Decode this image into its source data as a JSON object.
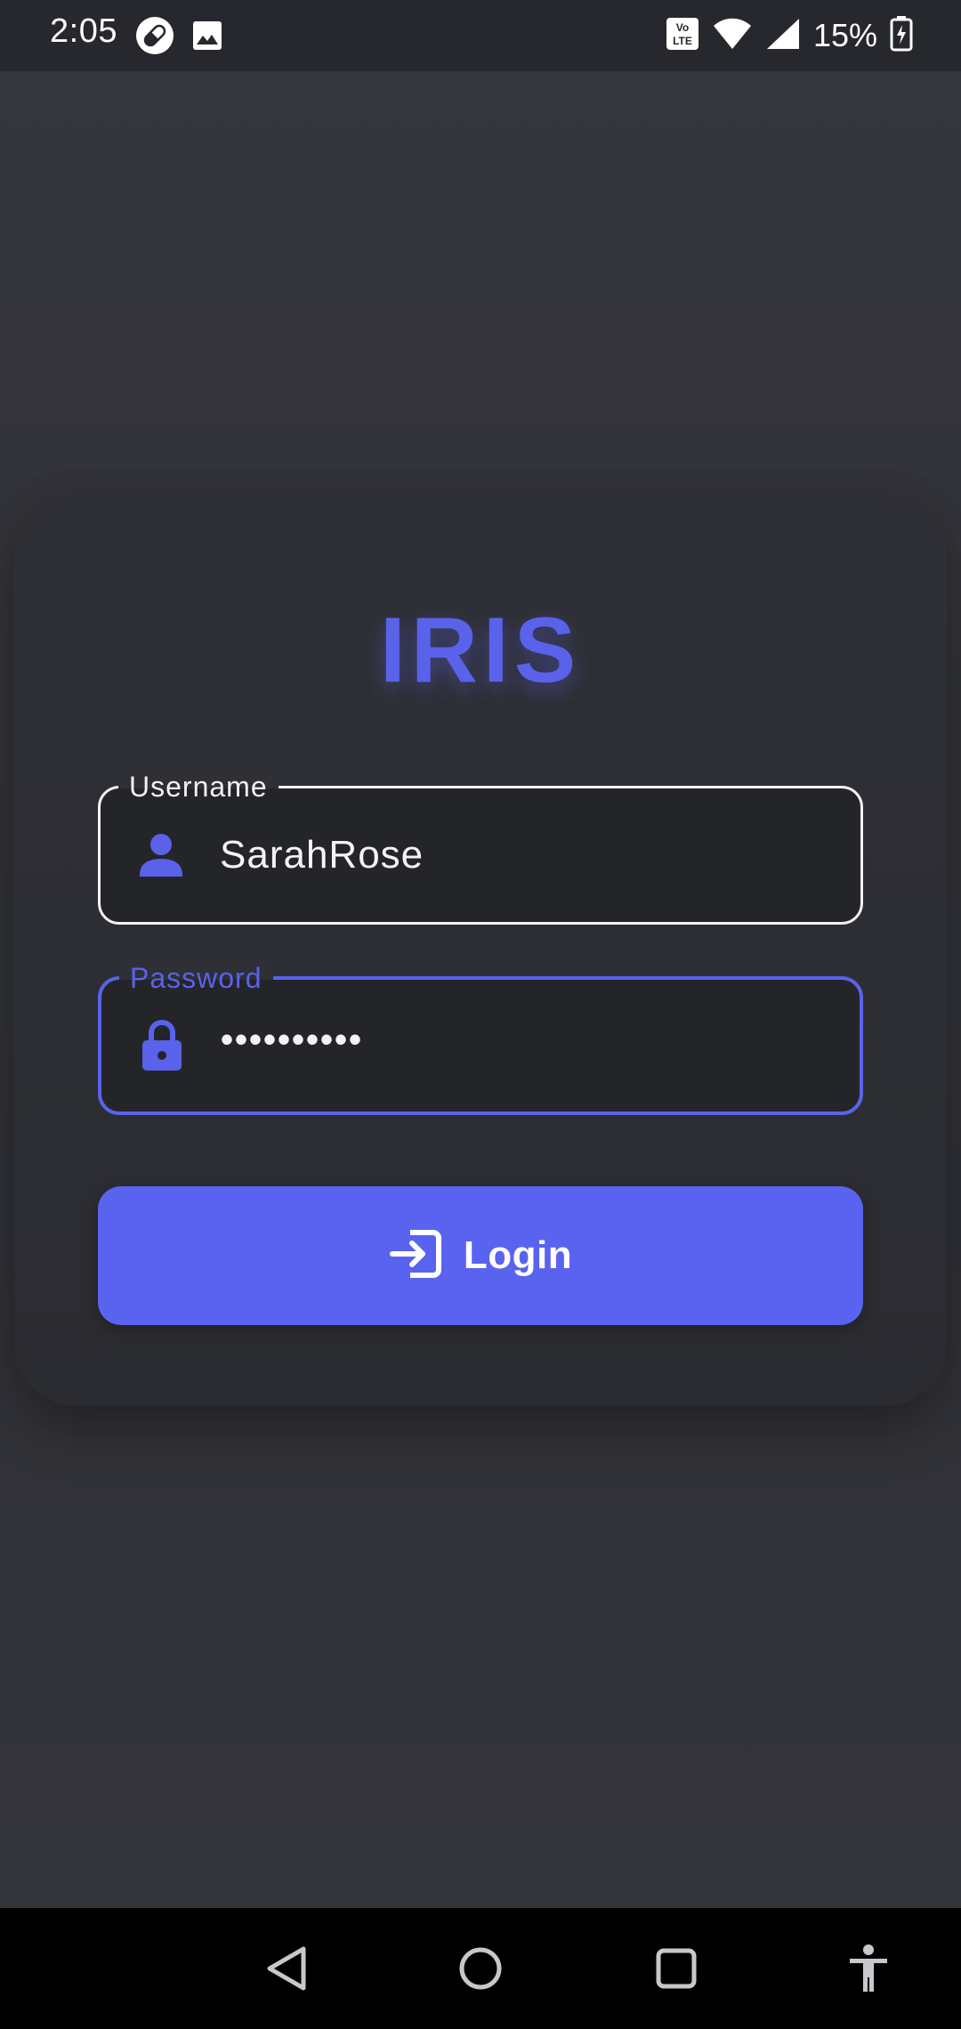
{
  "status_bar": {
    "time": "2:05",
    "battery_percent": "15%",
    "icons": [
      "pill-icon",
      "image-icon",
      "volte-icon",
      "wifi-icon",
      "signal-icon",
      "battery-charging-icon"
    ]
  },
  "login": {
    "app_title": "IRIS",
    "username": {
      "label": "Username",
      "value": "SarahRose",
      "icon": "person-icon"
    },
    "password": {
      "label": "Password",
      "value": "••••••••••",
      "icon": "lock-icon"
    },
    "submit": {
      "label": "Login",
      "icon": "login-icon"
    }
  },
  "nav_bar": {
    "buttons": [
      "back-icon",
      "home-icon",
      "recents-icon",
      "accessibility-icon"
    ]
  },
  "colors": {
    "accent": "#5a62ea",
    "background": "#35363c",
    "field_background": "#242529",
    "text": "#f4f4f6"
  }
}
